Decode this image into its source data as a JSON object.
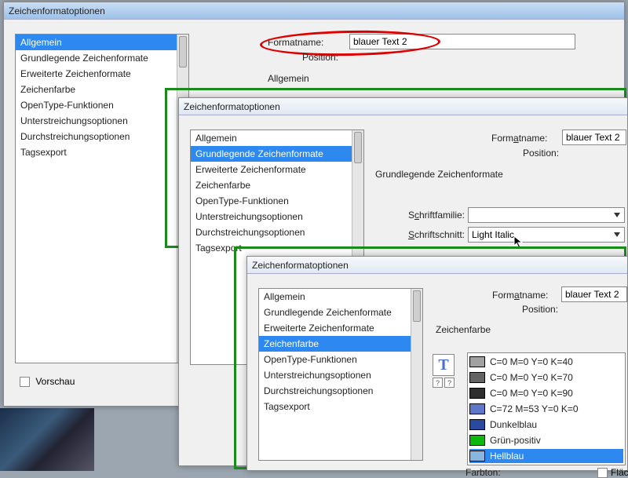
{
  "dialog1": {
    "title": "Zeichenformatoptionen",
    "formatname_label": "Formatname:",
    "formatname_value": "blauer Text 2",
    "position_label": "Position:",
    "section": "Allgemein",
    "sidebar": [
      "Allgemein",
      "Grundlegende Zeichenformate",
      "Erweiterte Zeichenformate",
      "Zeichenfarbe",
      "OpenType-Funktionen",
      "Unterstreichungsoptionen",
      "Durchstreichungsoptionen",
      "Tagsexport"
    ],
    "sidebar_sel": 0,
    "preview_label": "Vorschau"
  },
  "dialog2": {
    "title": "Zeichenformatoptionen",
    "formatname_label": "Formatname:",
    "formatname_value": "blauer Text 2",
    "position_label": "Position:",
    "section": "Grundlegende Zeichenformate",
    "sidebar": [
      "Allgemein",
      "Grundlegende Zeichenformate",
      "Erweiterte Zeichenformate",
      "Zeichenfarbe",
      "OpenType-Funktionen",
      "Unterstreichungsoptionen",
      "Durchstreichungsoptionen",
      "Tagsexport"
    ],
    "sidebar_sel": 1,
    "schriftfamilie_label": "Schriftfamilie:",
    "schriftfamilie_value": "",
    "schriftschnitt_label": "Schriftschnitt:",
    "schriftschnitt_value": "Light Italic"
  },
  "dialog3": {
    "title": "Zeichenformatoptionen",
    "formatname_label": "Formatname:",
    "formatname_value": "blauer Text 2",
    "position_label": "Position:",
    "section": "Zeichenfarbe",
    "sidebar": [
      "Allgemein",
      "Grundlegende Zeichenformate",
      "Erweiterte Zeichenformate",
      "Zeichenfarbe",
      "OpenType-Funktionen",
      "Unterstreichungsoptionen",
      "Durchstreichungsoptionen",
      "Tagsexport"
    ],
    "sidebar_sel": 3,
    "swatches": [
      {
        "name": "C=0 M=0 Y=0 K=40",
        "color": "#a1a1a1"
      },
      {
        "name": "C=0 M=0 Y=0 K=70",
        "color": "#636363"
      },
      {
        "name": "C=0 M=0 Y=0 K=90",
        "color": "#2e2e2e"
      },
      {
        "name": "C=72 M=53 Y=0 K=0",
        "color": "#5f77c9"
      },
      {
        "name": "Dunkelblau",
        "color": "#2a4aa0"
      },
      {
        "name": "Grün-positiv",
        "color": "#0bb80b"
      },
      {
        "name": "Hellblau",
        "color": "#87b6e0"
      }
    ],
    "swatches_sel": 6,
    "farbton_label": "Farbton:",
    "flaeche_label": "Fläche"
  }
}
